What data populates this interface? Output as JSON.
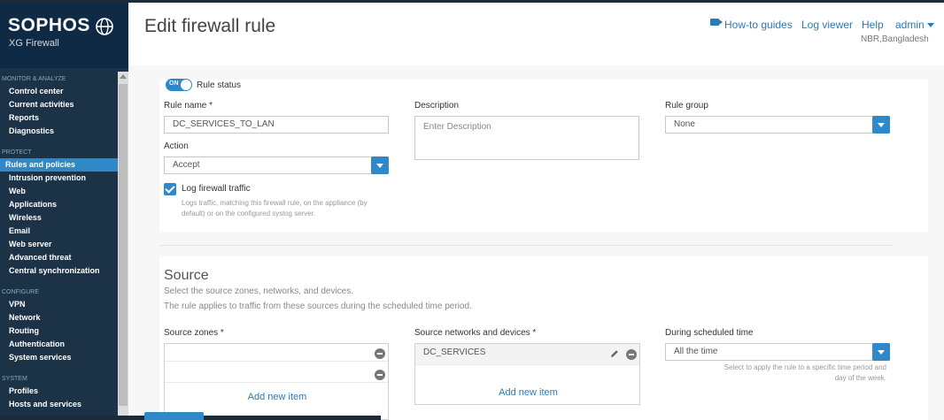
{
  "brand": {
    "logo": "SOPHOS",
    "product": "XG Firewall"
  },
  "sidebar": {
    "sections": [
      {
        "heading": "MONITOR & ANALYZE",
        "items": [
          "Control center",
          "Current activities",
          "Reports",
          "Diagnostics"
        ]
      },
      {
        "heading": "PROTECT",
        "items": [
          "Rules and policies",
          "Intrusion prevention",
          "Web",
          "Applications",
          "Wireless",
          "Email",
          "Web server",
          "Advanced threat",
          "Central synchronization"
        ]
      },
      {
        "heading": "CONFIGURE",
        "items": [
          "VPN",
          "Network",
          "Routing",
          "Authentication",
          "System services"
        ]
      },
      {
        "heading": "SYSTEM",
        "items": [
          "Profiles",
          "Hosts and services"
        ]
      }
    ],
    "active_item": "Rules and policies"
  },
  "header": {
    "title": "Edit firewall rule",
    "links": {
      "howto": "How-to guides",
      "logviewer": "Log viewer",
      "help": "Help",
      "user": "admin"
    },
    "location": "NBR,Bangladesh"
  },
  "form": {
    "rule_status": {
      "toggle_text": "ON",
      "label": "Rule status",
      "on": true
    },
    "rule_name": {
      "label": "Rule name *",
      "value": "DC_SERVICES_TO_LAN"
    },
    "description": {
      "label": "Description",
      "placeholder": "Enter Description"
    },
    "rule_group": {
      "label": "Rule group",
      "value": "None"
    },
    "action": {
      "label": "Action",
      "value": "Accept"
    },
    "log_traffic": {
      "label": "Log firewall traffic",
      "checked": true,
      "help_line1": "Logs traffic, matching this firewall rule, on the appliance (by",
      "help_line2": "default) or on the configured syslog server."
    }
  },
  "source": {
    "heading": "Source",
    "desc1": "Select the source zones, networks, and devices.",
    "desc2": "The rule applies to traffic from these sources during the scheduled time period.",
    "zones": {
      "label": "Source zones *",
      "add": "Add new item"
    },
    "networks": {
      "label": "Source networks and devices *",
      "item": "DC_SERVICES",
      "add": "Add new item"
    },
    "schedule": {
      "label": "During scheduled time",
      "value": "All the time",
      "help1": "Select to apply the rule to a specific time period and",
      "help2": "day of the week."
    }
  },
  "colors": {
    "accent": "#2f88c8",
    "sidebar": "#1c3347",
    "link": "#2a7ab8"
  }
}
